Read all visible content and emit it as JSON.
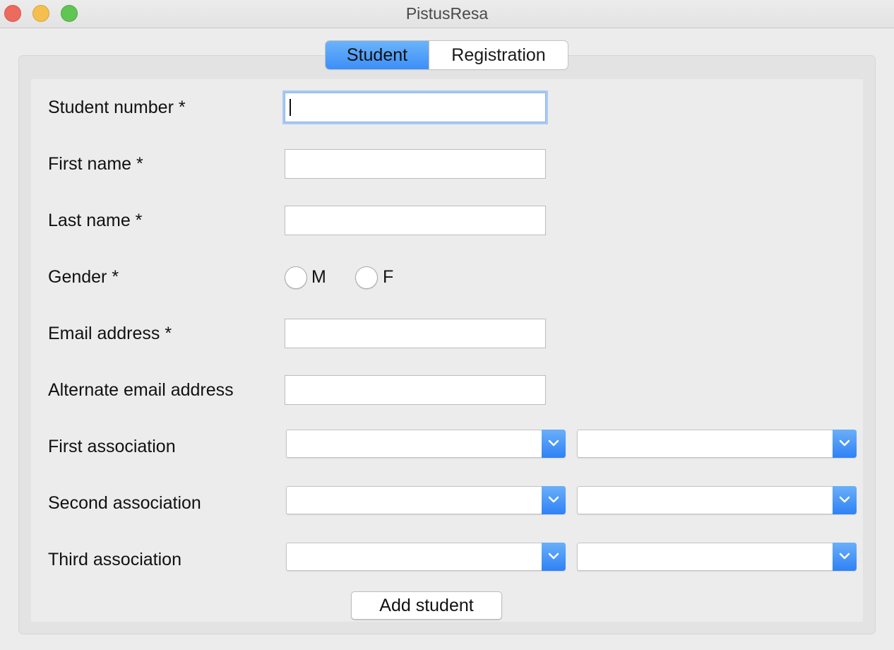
{
  "window": {
    "title": "PistusResa"
  },
  "tabs": [
    {
      "label": "Student",
      "active": true
    },
    {
      "label": "Registration",
      "active": false
    }
  ],
  "form": {
    "student_number": {
      "label": "Student number *",
      "value": ""
    },
    "first_name": {
      "label": "First name *",
      "value": ""
    },
    "last_name": {
      "label": "Last name *",
      "value": ""
    },
    "gender": {
      "label": "Gender *",
      "options": [
        "M",
        "F"
      ],
      "selected": null
    },
    "email": {
      "label": "Email address *",
      "value": ""
    },
    "alt_email": {
      "label": "Alternate email address",
      "value": ""
    },
    "first_association": {
      "label": "First association",
      "value_a": "",
      "value_b": ""
    },
    "second_association": {
      "label": "Second association",
      "value_a": "",
      "value_b": ""
    },
    "third_association": {
      "label": "Third association",
      "value_a": "",
      "value_b": ""
    },
    "submit_label": "Add student"
  },
  "colors": {
    "accent": "#3c8ff8",
    "close": "#ed6a5e",
    "minimize": "#f5bf4f",
    "maximize": "#61c554"
  },
  "icons": [
    "chevron-down-icon"
  ]
}
